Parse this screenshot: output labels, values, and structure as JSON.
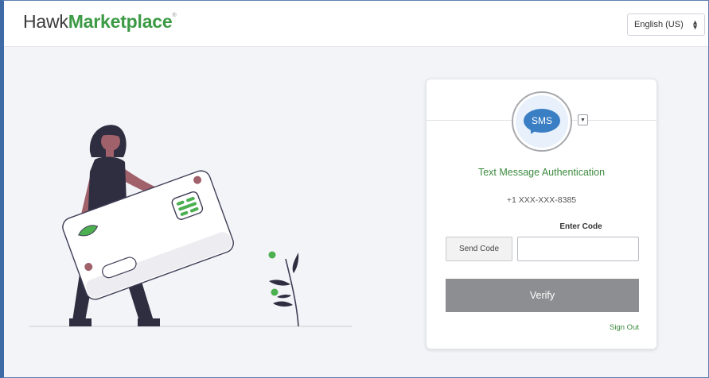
{
  "header": {
    "logo_part1": "Hawk",
    "logo_part2": "Marketplace",
    "logo_mark": "®",
    "language": "English (US)"
  },
  "auth": {
    "factor_badge": "SMS",
    "title": "Text Message Authentication",
    "phone": "+1 XXX-XXX-8385",
    "code_label": "Enter Code",
    "send_code": "Send Code",
    "code_value": "",
    "verify": "Verify",
    "sign_out": "Sign Out"
  },
  "colors": {
    "brand_green": "#3c9a45",
    "verify_gray": "#8d8e91",
    "sms_blue": "#3a7ec4"
  },
  "icons": {
    "dropdown": "chevron-down-icon",
    "language_caret": "updown-caret-icon",
    "factor": "sms-icon"
  }
}
